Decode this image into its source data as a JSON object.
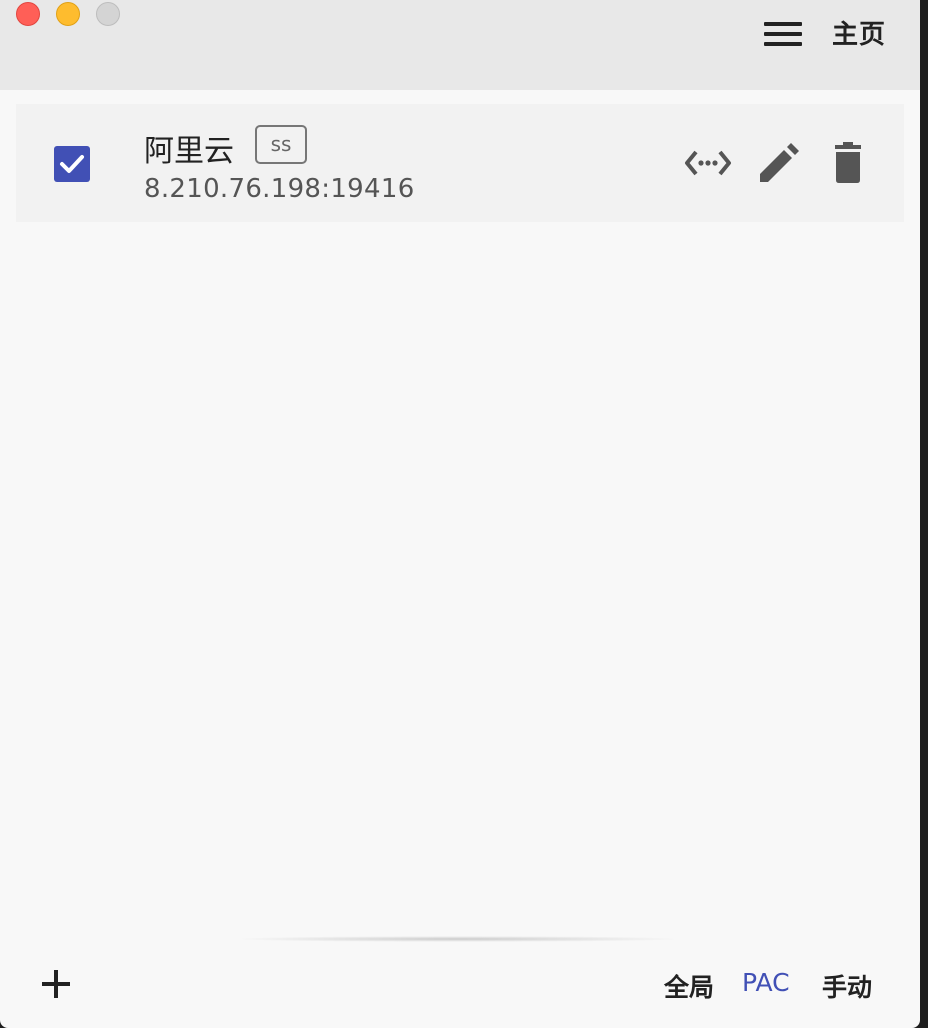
{
  "window": {
    "controls": [
      "close",
      "minimize",
      "maximize"
    ]
  },
  "header": {
    "menu_icon": "hamburger-menu-icon",
    "title": "主页"
  },
  "servers": [
    {
      "checked": true,
      "name": "阿里云",
      "type": "ss",
      "address": "8.210.76.198:19416",
      "actions": [
        "connection-test-icon",
        "edit-icon",
        "delete-icon"
      ]
    }
  ],
  "footer": {
    "add_icon": "plus-icon",
    "modes": [
      "全局",
      "PAC",
      "手动"
    ],
    "active_mode": "PAC"
  },
  "colors": {
    "accent": "#4150b5",
    "titlebar": "#e8e8e8",
    "background": "#f8f8f8"
  }
}
